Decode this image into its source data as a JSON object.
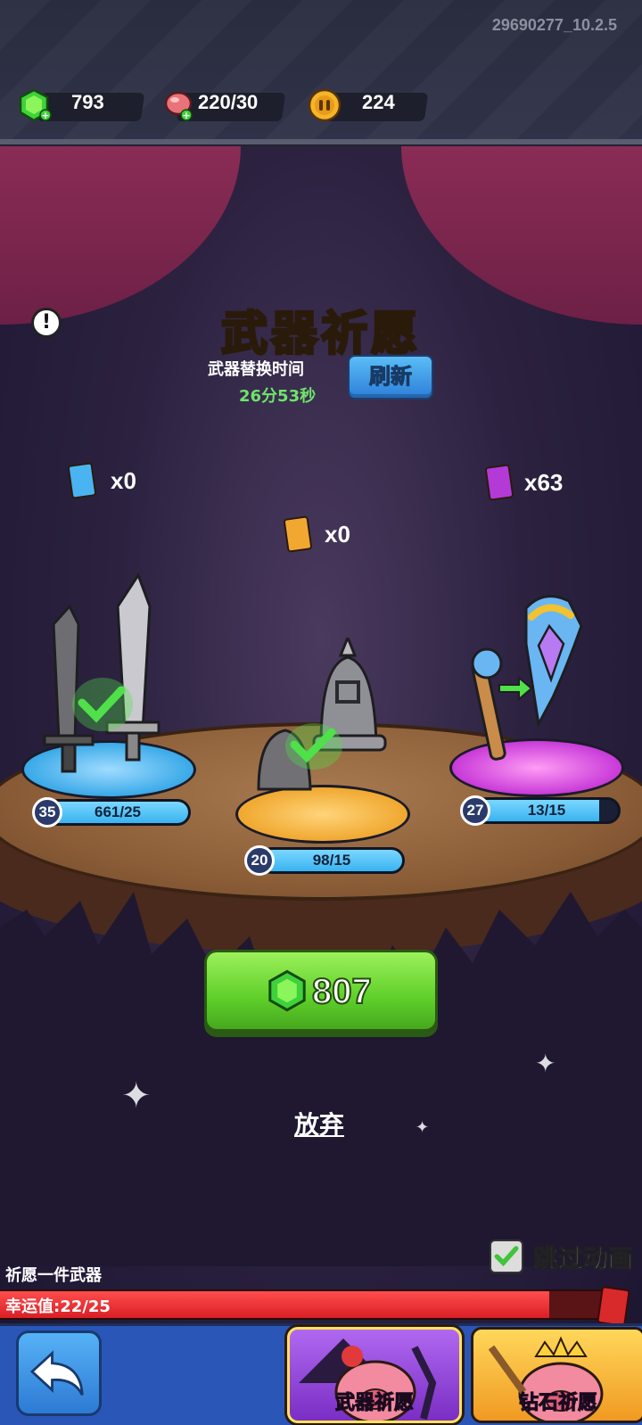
{
  "version": "29690277_10.2.5",
  "resources": {
    "gems": "793",
    "energy": "220/30",
    "coins": "224"
  },
  "title": "武器祈愿",
  "subtitle": "武器替换时间",
  "timer": "26分53秒",
  "refresh_label": "刷新",
  "cards": {
    "blue": "x0",
    "orange": "x0",
    "purple": "x63"
  },
  "weapons": [
    {
      "name": "swords",
      "level": "35",
      "progress": "661/25",
      "fill": 1.0,
      "pedestal_color": "#3aa9e8"
    },
    {
      "name": "bells",
      "level": "20",
      "progress": "98/15",
      "fill": 1.0,
      "pedestal_color": "#f0a830"
    },
    {
      "name": "staff",
      "level": "27",
      "progress": "13/15",
      "fill": 0.8667,
      "pedestal_color": "#c83ad8"
    }
  ],
  "cost": "807",
  "give_up_label": "放弃",
  "skip_animation_label": "跳过动画",
  "wish_label": "祈愿一件武器",
  "luck": {
    "text": "幸运值:22/25",
    "fill": 0.88
  },
  "tabs": {
    "weapon_wish": "武器祈愿",
    "diamond_wish": "钻石祈愿"
  },
  "colors": {
    "accent_green": "#5fcf2a",
    "title_yellow": "#ffd83a",
    "timer_green": "#6fe36b",
    "luck_red": "#d91f25"
  }
}
